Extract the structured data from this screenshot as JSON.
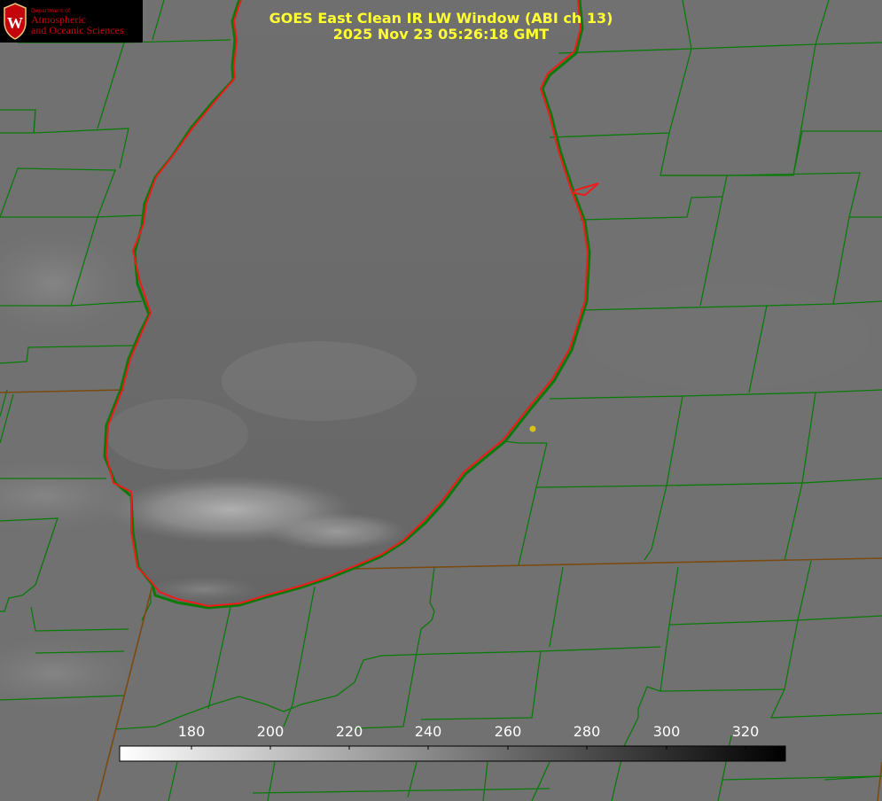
{
  "header": {
    "title_line1": "GOES East Clean IR LW Window (ABI ch 13)",
    "title_line2": "2025 Nov 23 05:26:18 GMT"
  },
  "logo": {
    "department": "Department of",
    "line1": "Atmospheric",
    "line2": "and Oceanic Sciences",
    "crest_letter": "W"
  },
  "colorbar": {
    "ticks": [
      "180",
      "200",
      "220",
      "240",
      "260",
      "280",
      "300",
      "320"
    ],
    "range": [
      162,
      332
    ],
    "gradient": "white-to-black"
  },
  "colors": {
    "title": "#ffff33",
    "coastline": "#ee1b1b",
    "county_lines": "#0a7a0a",
    "state_lines": "#7a4a10",
    "marker": "#d6c21a",
    "logo_red": "#c5050c"
  },
  "map": {
    "marker": "yellow-dot-station"
  }
}
